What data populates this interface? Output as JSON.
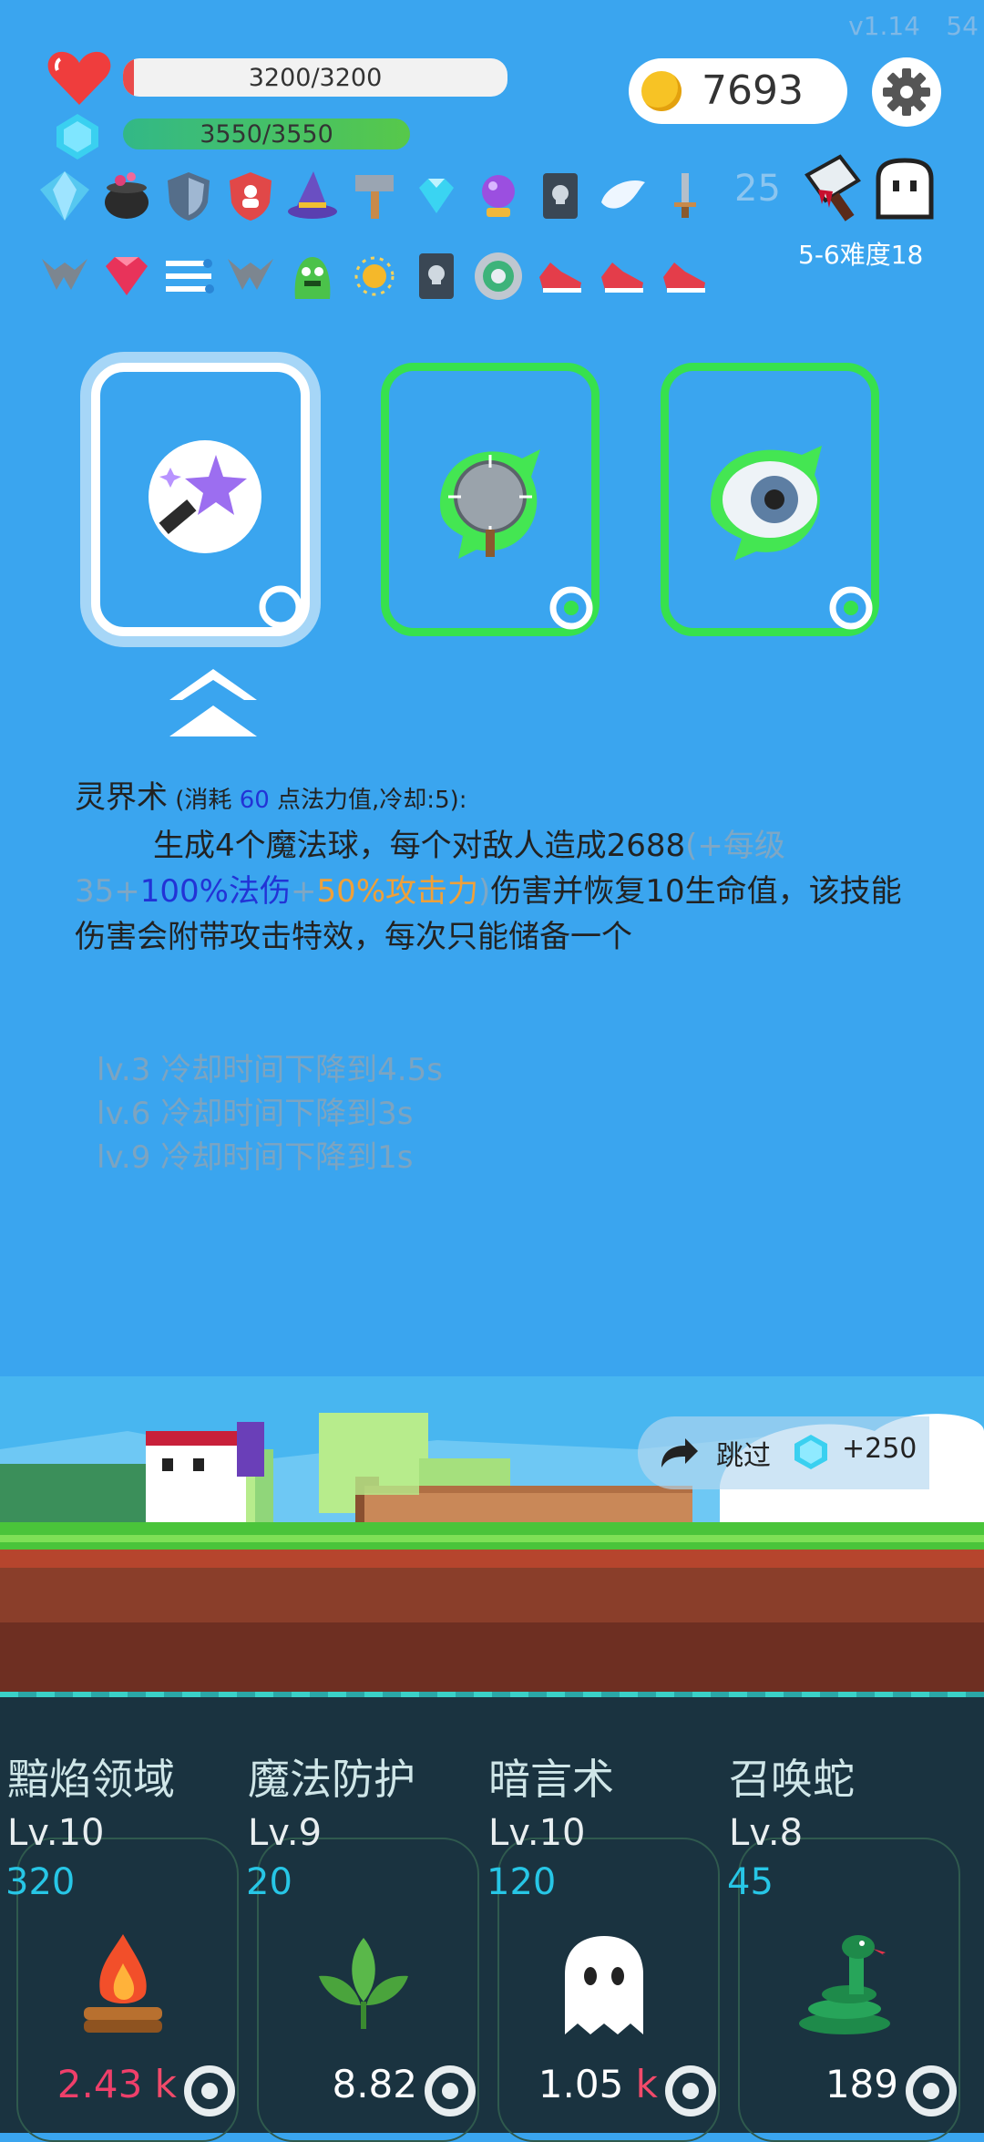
{
  "version": "v1.14",
  "version_suffix": "54",
  "hp": {
    "text": "3200/3200",
    "fraction": 1.0
  },
  "mp": {
    "text": "3550/3550",
    "fraction": 1.0
  },
  "coins": "7693",
  "buff_count": "25",
  "stage": "5-6难度18",
  "row1_icons": [
    "blue-crystal-icon",
    "cauldron-icon",
    "blue-shield-icon",
    "red-shield-icon",
    "wizard-hat-icon",
    "hammer-icon",
    "diamond-icon",
    "magic-orb-icon",
    "skull-book-icon",
    "wing-icon",
    "sword-icon"
  ],
  "row2_icons": [
    "claw-icon",
    "red-gem-icon",
    "speed-lines-icon",
    "claw-icon",
    "green-monster-icon",
    "sun-icon",
    "skull-book-icon",
    "target-ring-icon",
    "red-shoe-icon",
    "red-shoe-icon",
    "red-shoe-icon"
  ],
  "cards": [
    {
      "name": "magic-wand-card",
      "selected": true
    },
    {
      "name": "spiked-mace-card",
      "selected": false
    },
    {
      "name": "eye-card",
      "selected": false
    }
  ],
  "skill_desc": {
    "title": "灵界术",
    "cost_prefix": " (消耗 ",
    "cost_value": "60",
    "cost_suffix": " 点法力值,冷却:5):",
    "line_start": "生成4个魔法球，每个对敌人造成2688",
    "gray1": "(+每级35+",
    "blue": "100%法伤",
    "gray2": "+",
    "orange": "50%攻击力",
    "gray3": ")",
    "rest": "伤害并恢复10生命值，该技能伤害会附带攻击特效，每次只能储备一个"
  },
  "levels": [
    "lv.3 冷却时间下降到4.5s",
    "lv.6 冷却时间下降到3s",
    "lv.9 冷却时间下降到1s"
  ],
  "skip": {
    "label": "跳过",
    "amount": "+250"
  },
  "skills": [
    {
      "name": "黯焰领域",
      "level": "Lv.10",
      "cost": "320",
      "value": "2.43",
      "unit": "k",
      "icon": "campfire-icon"
    },
    {
      "name": "魔法防护",
      "level": "Lv.9",
      "cost": "20",
      "value": "8.82",
      "unit": "",
      "icon": "leaf-icon"
    },
    {
      "name": "暗言术",
      "level": "Lv.10",
      "cost": "120",
      "value": "1.05",
      "unit": "k",
      "icon": "ghost-icon"
    },
    {
      "name": "召唤蛇",
      "level": "Lv.8",
      "cost": "45",
      "value": "189",
      "unit": "",
      "icon": "snake-icon"
    }
  ]
}
